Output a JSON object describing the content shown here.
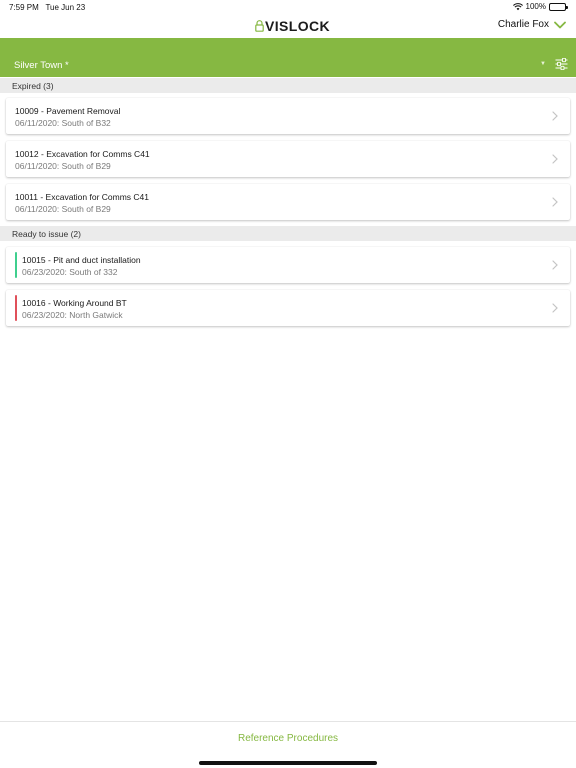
{
  "status_bar": {
    "time": "7:59 PM",
    "date": "Tue Jun 23",
    "battery": "100%",
    "wifi_icon": "wifi-icon",
    "battery_icon": "battery-icon"
  },
  "header": {
    "logo_text": "VISLOCK",
    "logo_icon": "padlock-icon",
    "user_name": "Charlie Fox",
    "user_menu_icon": "chevron-down-icon"
  },
  "filter_bar": {
    "site": "Silver Town *",
    "dropdown_icon": "caret-down-icon",
    "filter_icon": "sliders-icon"
  },
  "sections": [
    {
      "title": "Expired (3)",
      "items": [
        {
          "title": "10009 - Pavement Removal",
          "subtitle": "06/11/2020: South of B32"
        },
        {
          "title": "10012 - Excavation for Comms C41",
          "subtitle": "06/11/2020: South of B29"
        },
        {
          "title": "10011 - Excavation for Comms C41",
          "subtitle": "06/11/2020: South of B29"
        }
      ]
    },
    {
      "title": "Ready to issue (2)",
      "items": [
        {
          "title": "10015 - Pit and duct installation",
          "subtitle": "06/23/2020: South of 332",
          "status_color": "#3fcf8e"
        },
        {
          "title": "10016 - Working Around BT",
          "subtitle": "06/23/2020: North Gatwick",
          "status_color": "#e0505a"
        }
      ]
    }
  ],
  "footer": {
    "link": "Reference Procedures"
  },
  "colors": {
    "brand_green": "#86b842",
    "section_bg": "#ebebeb",
    "chevron": "#c4c4c4"
  }
}
